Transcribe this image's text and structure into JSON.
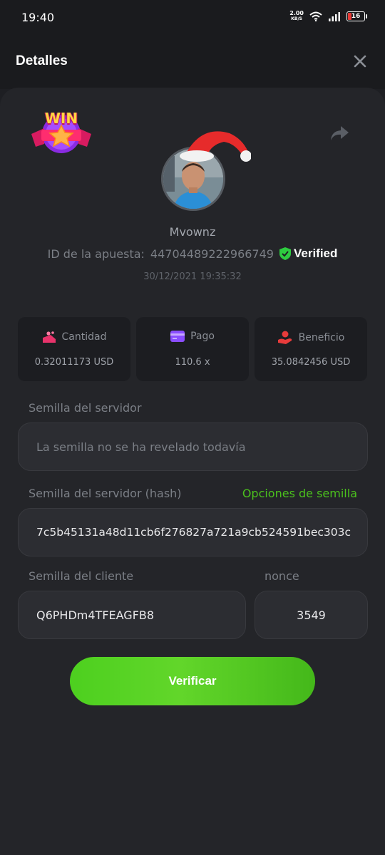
{
  "status": {
    "time": "19:40",
    "net_speed_value": "2.00",
    "net_speed_unit": "KB/S",
    "battery": "16"
  },
  "header": {
    "title": "Detalles"
  },
  "player": {
    "username": "Mvownz",
    "bet_id_label": "ID de la apuesta:",
    "bet_id": "44704489222966749",
    "verified_label": "Verified",
    "datetime": "30/12/2021 19:35:32",
    "win_badge_text": "WIN"
  },
  "stats": [
    {
      "label": "Cantidad",
      "value": "0.32011173 USD",
      "icon": "amount-icon",
      "color": "#e8336b"
    },
    {
      "label": "Pago",
      "value": "110.6 x",
      "icon": "payout-card-icon",
      "color": "#8a4dff"
    },
    {
      "label": "Beneficio",
      "value": "35.0842456 USD",
      "icon": "profit-hand-icon",
      "color": "#e83b3b"
    }
  ],
  "server_seed": {
    "label": "Semilla del servidor",
    "value": "La semilla no se ha revelado todavía"
  },
  "server_seed_hash": {
    "label": "Semilla del servidor (hash)",
    "options_link": "Opciones de semilla",
    "value": "7c5b45131a48d11cb6f276827a721a9cb524591bec303c"
  },
  "client_seed": {
    "label": "Semilla del cliente",
    "value": "Q6PHDm4TFEAGFB8"
  },
  "nonce": {
    "label": "nonce",
    "value": "3549"
  },
  "verify_button": {
    "label": "Verificar"
  },
  "colors": {
    "accent_green": "#4bc11d",
    "background": "#1e1f23",
    "card": "#242529",
    "verified_shield": "#2ecc40"
  }
}
